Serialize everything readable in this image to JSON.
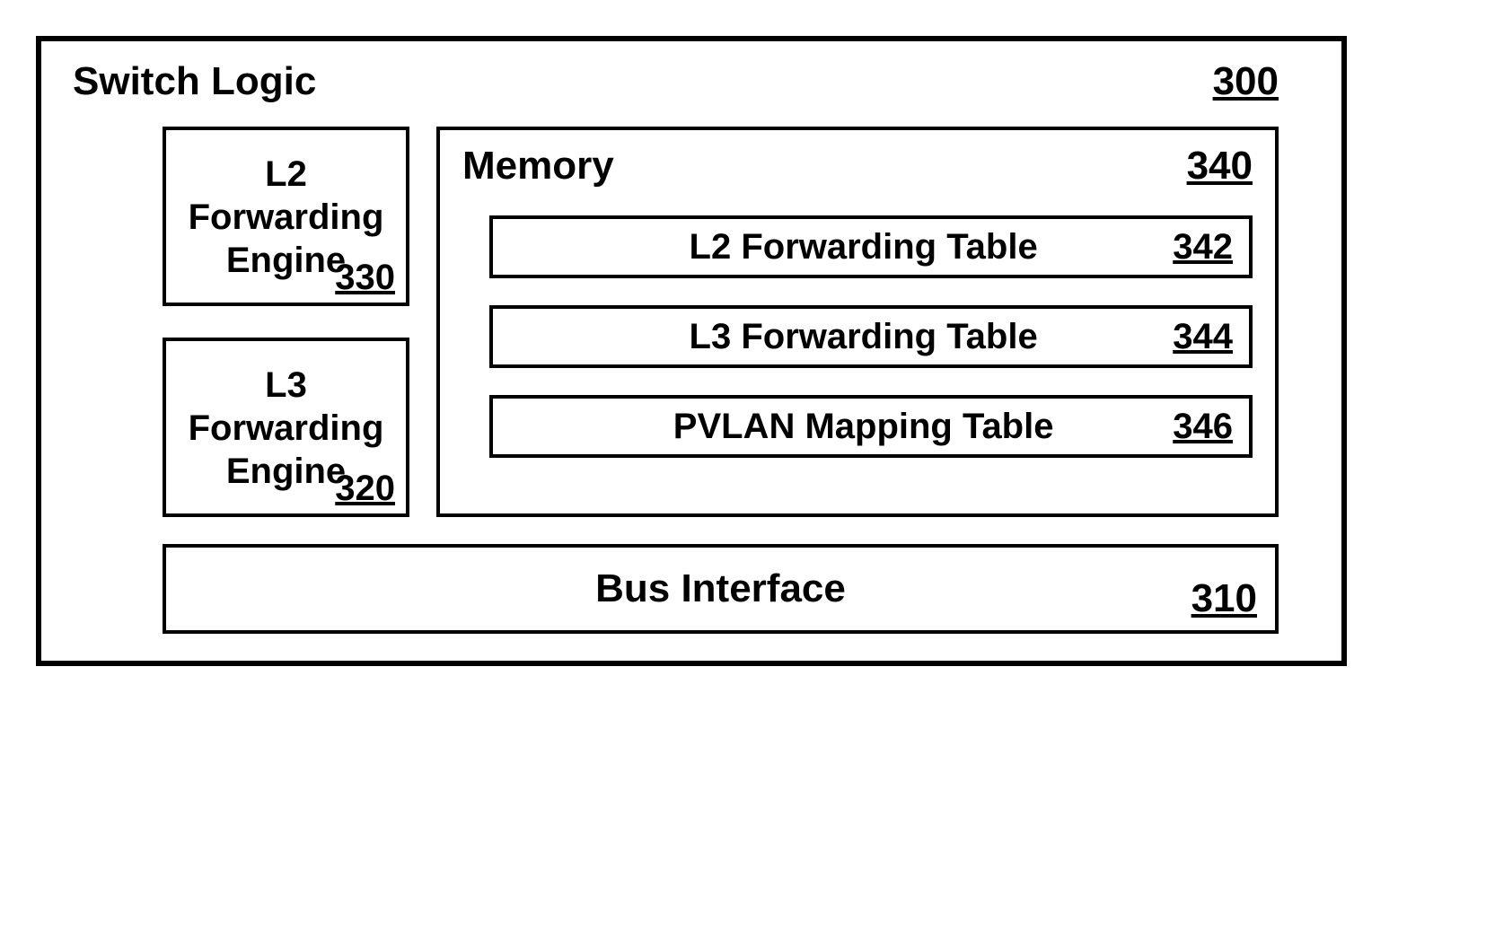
{
  "diagram": {
    "title": "Switch Logic",
    "ref": "300",
    "engines": [
      {
        "label": "L2\nForwarding\nEngine",
        "ref": "330"
      },
      {
        "label": "L3\nForwarding\nEngine",
        "ref": "320"
      }
    ],
    "memory": {
      "title": "Memory",
      "ref": "340",
      "tables": [
        {
          "label": "L2 Forwarding Table",
          "ref": "342"
        },
        {
          "label": "L3 Forwarding Table",
          "ref": "344"
        },
        {
          "label": "PVLAN Mapping Table",
          "ref": "346"
        }
      ]
    },
    "bus": {
      "label": "Bus Interface",
      "ref": "310"
    }
  }
}
